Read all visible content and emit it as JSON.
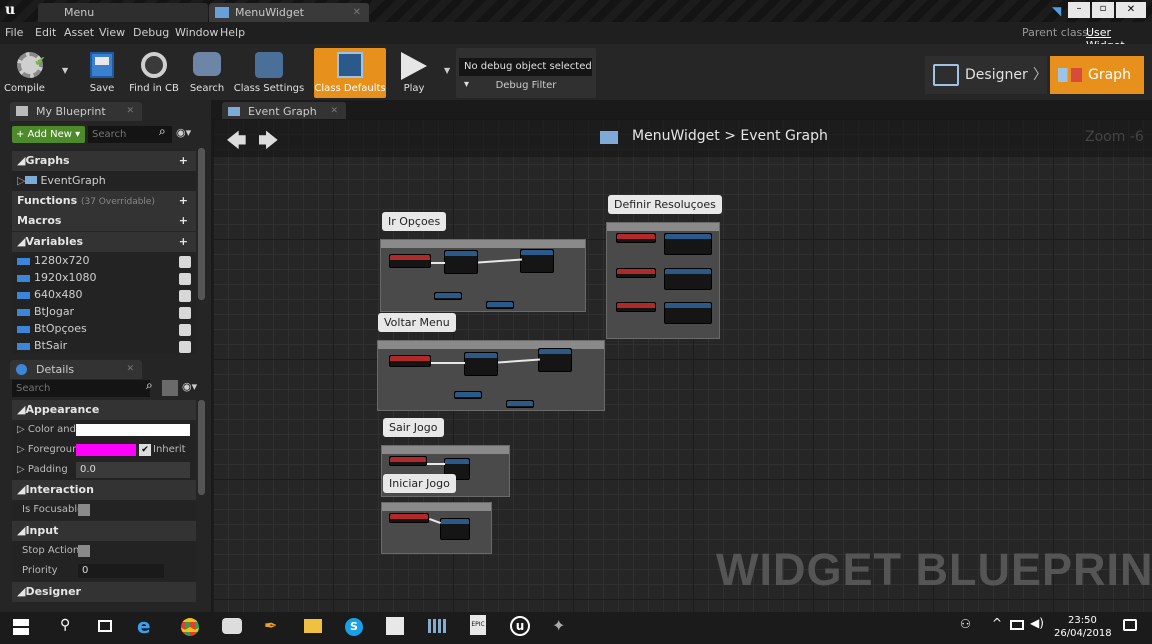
{
  "titlebar": {
    "tabs": [
      {
        "label": "Menu"
      },
      {
        "label": "MenuWidget"
      }
    ]
  },
  "menubar": {
    "items": [
      "File",
      "Edit",
      "Asset",
      "View",
      "Debug",
      "Window",
      "Help"
    ],
    "parent_class_label": "Parent class:",
    "parent_class_value": "User Widget"
  },
  "toolbar": {
    "buttons": [
      "Compile",
      "Save",
      "Find in CB",
      "Search",
      "Class Settings",
      "Class Defaults",
      "Play"
    ],
    "debug_select": "No debug object selected",
    "debug_filter": "Debug Filter",
    "designer": "Designer",
    "graph": "Graph"
  },
  "my_blueprint": {
    "tab": "My Blueprint",
    "add_new": "+ Add New",
    "search_placeholder": "Search",
    "graphs": "Graphs",
    "event_graph": "EventGraph",
    "functions": "Functions",
    "functions_note": "(37 Overridable)",
    "macros": "Macros",
    "variables": "Variables",
    "vars": [
      "1280x720",
      "1920x1080",
      "640x480",
      "BtJogar",
      "BtOpçoes",
      "BtSair"
    ]
  },
  "details": {
    "tab": "Details",
    "search_placeholder": "Search",
    "appearance": "Appearance",
    "color_label": "Color and O",
    "foreground": "Foreground",
    "inherit": "Inherit",
    "padding": "Padding",
    "padding_value": "0.0",
    "interaction": "Interaction",
    "is_focusable": "Is Focusable",
    "input": "Input",
    "stop_action": "Stop Action",
    "priority": "Priority",
    "priority_value": "0",
    "designer": "Designer"
  },
  "graph": {
    "tab": "Event Graph",
    "breadcrumb_root": "MenuWidget",
    "breadcrumb_sep": ">",
    "breadcrumb_leaf": "Event Graph",
    "zoom": "Zoom -6",
    "watermark": "WIDGET BLUEPRINT",
    "comments": [
      "Ir Opçoes",
      "Definir Resoluçoes",
      "Voltar Menu",
      "Sair Jogo",
      "Iniciar Jogo"
    ]
  },
  "taskbar": {
    "time": "23:50",
    "date": "26/04/2018"
  },
  "colors": {
    "accent": "#e8901c",
    "var": "#3b86d8",
    "foreground_swatch": "#ff00ff"
  }
}
